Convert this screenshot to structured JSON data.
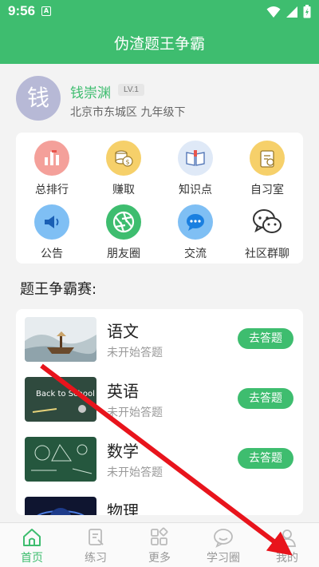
{
  "status_bar": {
    "time": "9:56",
    "notif_letter": "A"
  },
  "app": {
    "title": "伪渣题王争霸"
  },
  "user": {
    "avatar_char": "钱",
    "name": "钱崇渊",
    "level": "LV.1",
    "bio": "北京市东城区 九年级下"
  },
  "grid": [
    {
      "label": "总排行",
      "icon": "bar-chart-icon",
      "color": "#f4a09a"
    },
    {
      "label": "赚取",
      "icon": "coins-icon",
      "color": "#f6d06a"
    },
    {
      "label": "知识点",
      "icon": "book-icon",
      "color": "#dfe9f7"
    },
    {
      "label": "自习室",
      "icon": "clipboard-icon",
      "color": "#f6d06a"
    },
    {
      "label": "公告",
      "icon": "megaphone-icon",
      "color": "#7fbff4"
    },
    {
      "label": "朋友圈",
      "icon": "aperture-icon",
      "color": "#3ebd6f"
    },
    {
      "label": "交流",
      "icon": "chat-bubble-icon",
      "color": "#7fbff4"
    },
    {
      "label": "社区群聊",
      "icon": "wechat-icon",
      "color": "#ffffff"
    }
  ],
  "section": {
    "title": "题王争霸赛:"
  },
  "subjects": [
    {
      "name": "语文",
      "status": "未开始答题",
      "button": "去答题",
      "thumb": "landscape-painting"
    },
    {
      "name": "英语",
      "status": "未开始答题",
      "button": "去答题",
      "thumb": "chalkboard-back-to-school"
    },
    {
      "name": "数学",
      "status": "未开始答题",
      "button": "去答题",
      "thumb": "chalkboard-formulas"
    },
    {
      "name": "物理",
      "status": "",
      "button": "",
      "thumb": "galaxy"
    }
  ],
  "thumb_text": {
    "english": "Back to School"
  },
  "tabs": [
    {
      "label": "首页",
      "icon": "home-icon",
      "active": true
    },
    {
      "label": "练习",
      "icon": "practice-icon",
      "active": false
    },
    {
      "label": "更多",
      "icon": "more-grid-icon",
      "active": false
    },
    {
      "label": "学习圈",
      "icon": "study-circle-icon",
      "active": false
    },
    {
      "label": "我的",
      "icon": "profile-icon",
      "active": false
    }
  ],
  "colors": {
    "brand": "#3ebd6f",
    "arrow": "#e8141c"
  }
}
